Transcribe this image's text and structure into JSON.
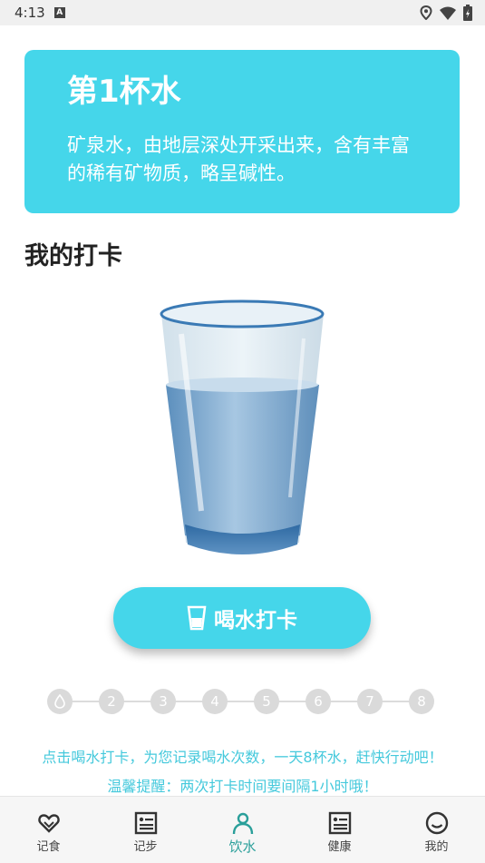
{
  "status_bar": {
    "time": "4:13",
    "badge": "A"
  },
  "card": {
    "title": "第1杯水",
    "description": "矿泉水，由地层深处开采出来，含有丰富的稀有矿物质，略呈碱性。"
  },
  "section_title": "我的打卡",
  "checkin_button": {
    "label": "喝水打卡"
  },
  "progress": {
    "total": 8,
    "completed": 0,
    "steps": [
      "",
      "2",
      "3",
      "4",
      "5",
      "6",
      "7",
      "8"
    ]
  },
  "hints": {
    "line1": "点击喝水打卡，为您记录喝水次数，一天8杯水，赶快行动吧！",
    "line2": "温馨提醒：两次打卡时间要间隔1小时哦！"
  },
  "tabs": [
    {
      "label": "记食",
      "icon": "heart-icon",
      "active": false
    },
    {
      "label": "记步",
      "icon": "list-icon",
      "active": false
    },
    {
      "label": "饮水",
      "icon": "person-icon",
      "active": true
    },
    {
      "label": "健康",
      "icon": "report-icon",
      "active": false
    },
    {
      "label": "我的",
      "icon": "smile-icon",
      "active": false
    }
  ],
  "colors": {
    "accent": "#45d6ea",
    "active_tab": "#2a9f9a",
    "hint": "#45c9dc"
  }
}
